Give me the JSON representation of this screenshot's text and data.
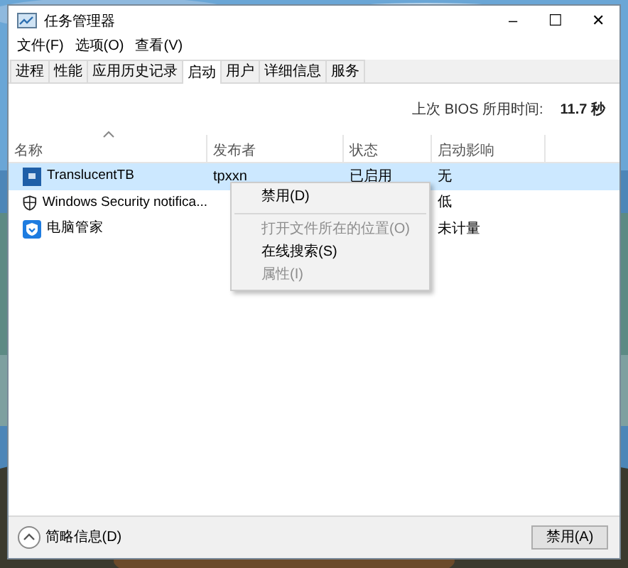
{
  "window": {
    "title": "任务管理器",
    "controls": [
      "–",
      "☐",
      "✕"
    ]
  },
  "menu": [
    "文件(F)",
    "选项(O)",
    "查看(V)"
  ],
  "tabs": [
    {
      "label": "进程",
      "selected": false
    },
    {
      "label": "性能",
      "selected": false
    },
    {
      "label": "应用历史记录",
      "selected": false
    },
    {
      "label": "启动",
      "selected": true
    },
    {
      "label": "用户",
      "selected": false
    },
    {
      "label": "详细信息",
      "selected": false
    },
    {
      "label": "服务",
      "selected": false
    }
  ],
  "bios": {
    "label": "上次 BIOS 所用时间:",
    "value": "11.7 秒"
  },
  "table": {
    "columns": [
      {
        "label": "名称",
        "sorted": true
      },
      {
        "label": "发布者",
        "sorted": false
      },
      {
        "label": "状态",
        "sorted": false
      },
      {
        "label": "启动影响",
        "sorted": false
      }
    ],
    "rows": [
      {
        "name": "TranslucentTB",
        "publisher": "tpxxn",
        "status": "已启用",
        "impact": "无",
        "selected": true
      },
      {
        "name": "Windows Security notifica...",
        "publisher": "",
        "status": "",
        "impact": "低",
        "selected": false
      },
      {
        "name": "电脑管家",
        "publisher": "",
        "status": "",
        "impact": "未计量",
        "selected": false
      }
    ]
  },
  "context_menu": [
    {
      "label": "禁用(D)",
      "disabled": false
    },
    {
      "kind": "separator"
    },
    {
      "label": "打开文件所在的位置(O)",
      "disabled": true
    },
    {
      "label": "在线搜索(S)",
      "disabled": false
    },
    {
      "label": "属性(I)",
      "disabled": true
    }
  ],
  "footer": {
    "details": "简略信息(D)",
    "button": "禁用(A)"
  }
}
